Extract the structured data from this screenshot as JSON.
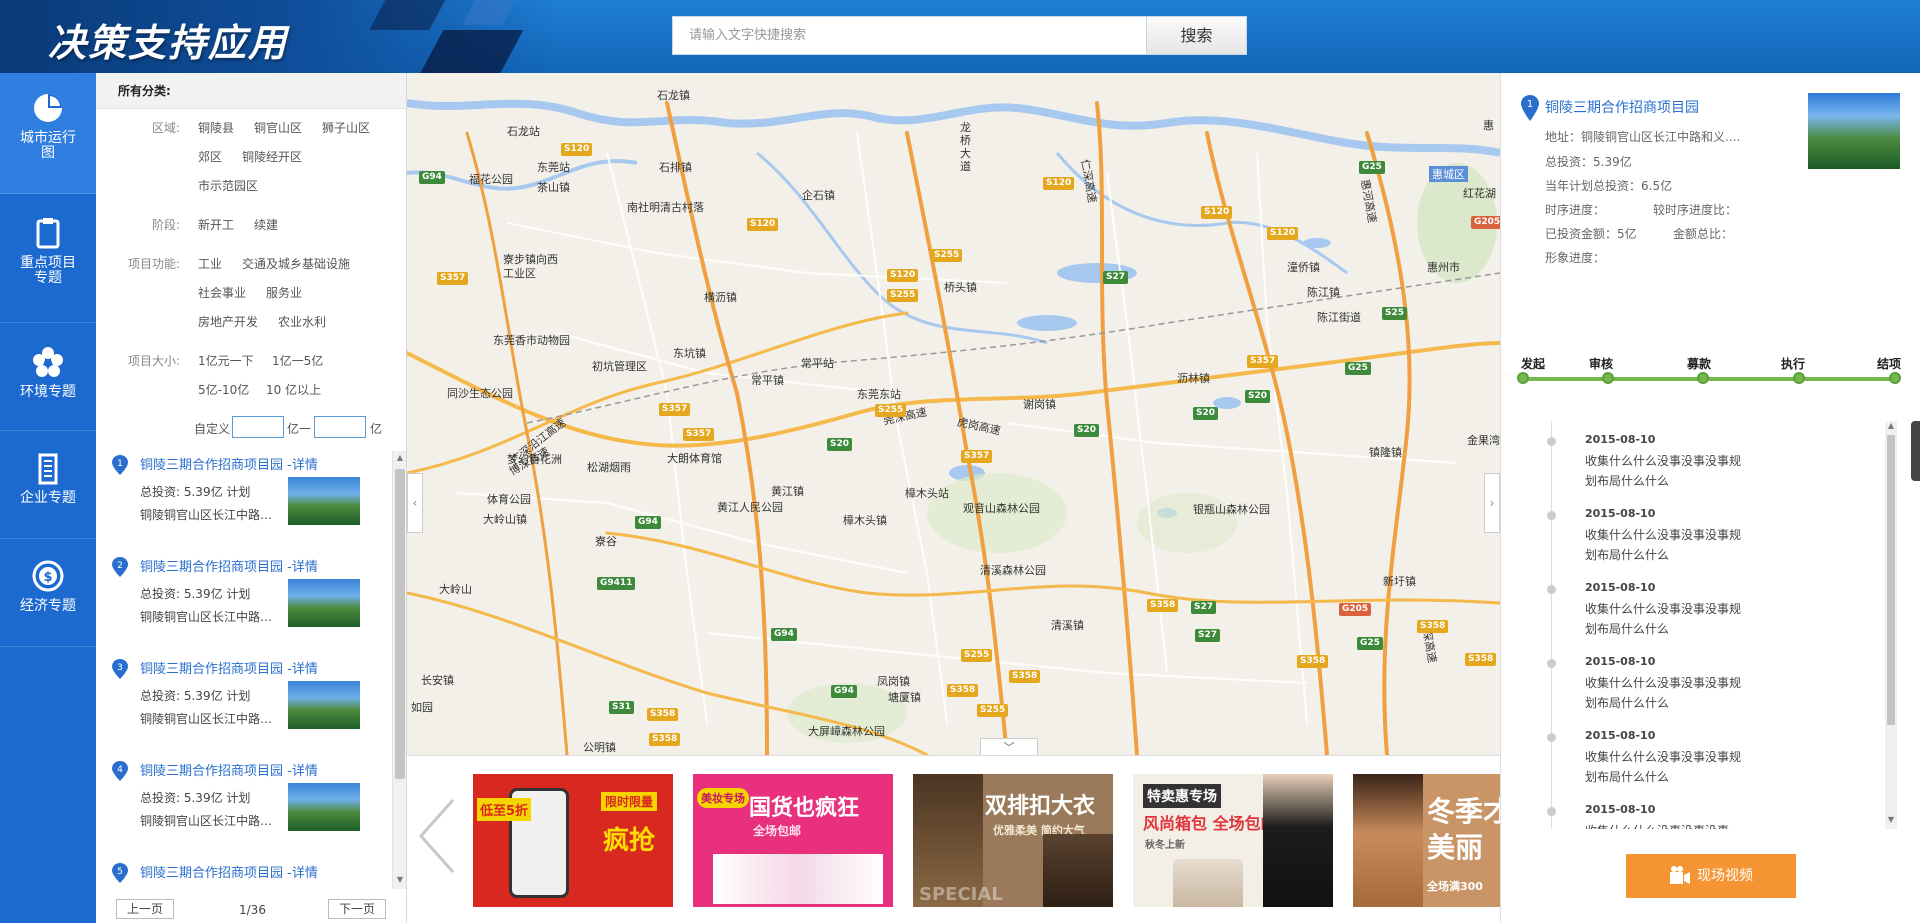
{
  "app": {
    "title": "决策支持应用"
  },
  "search": {
    "placeholder": "请输入文字快捷搜索",
    "button": "搜索"
  },
  "nav": [
    {
      "label": "城市运行图",
      "icon": "pie-chart-icon"
    },
    {
      "label": "重点项目专题",
      "icon": "clipboard-icon"
    },
    {
      "label": "环境专题",
      "icon": "flower-icon"
    },
    {
      "label": "企业专题",
      "icon": "building-icon"
    },
    {
      "label": "经济专题",
      "icon": "currency-icon"
    }
  ],
  "filters": {
    "all": "所有分类:",
    "region": {
      "label": "区域:",
      "options": [
        "铜陵县",
        "铜官山区",
        "狮子山区",
        "郊区",
        "铜陵经开区",
        "市示范园区"
      ]
    },
    "stage": {
      "label": "阶段:",
      "options": [
        "新开工",
        "续建"
      ]
    },
    "function": {
      "label": "项目功能:",
      "options": [
        "工业",
        "交通及城乡基础设施",
        "社会事业",
        "服务业",
        "房地产开发",
        "农业水利"
      ]
    },
    "size": {
      "label": "项目大小:",
      "options": [
        "1亿元一下",
        "1亿一5亿",
        "5亿-10亿",
        "10 亿以上"
      ]
    },
    "custom": {
      "label": "自定义",
      "unit1": "亿一",
      "unit2": "亿"
    }
  },
  "projects": [
    {
      "num": "1",
      "title": "铜陵三期合作招商项目园 -详情",
      "invest": "总投资: 5.39亿 计划",
      "addr": "铜陵铜官山区长江中路…"
    },
    {
      "num": "2",
      "title": "铜陵三期合作招商项目园 -详情",
      "invest": "总投资: 5.39亿 计划",
      "addr": "铜陵铜官山区长江中路…"
    },
    {
      "num": "3",
      "title": "铜陵三期合作招商项目园 -详情",
      "invest": "总投资: 5.39亿 计划",
      "addr": "铜陵铜官山区长江中路…"
    },
    {
      "num": "4",
      "title": "铜陵三期合作招商项目园 -详情",
      "invest": "总投资: 5.39亿 计划",
      "addr": "铜陵铜官山区长江中路…"
    },
    {
      "num": "5",
      "title": "铜陵三期合作招商项目园 -详情",
      "invest": "",
      "addr": ""
    }
  ],
  "pager": {
    "prev": "上一页",
    "info": "1/36",
    "next": "下一页"
  },
  "map": {
    "places": [
      "石龙镇",
      "石龙站",
      "东莞站",
      "茶山镇",
      "石排镇",
      "南社明清古村落",
      "企石镇",
      "龙桥大道",
      "桥头镇",
      "寮步镇向西工业区",
      "横沥镇",
      "东莞香市动物园",
      "初坑管理区",
      "东坑镇",
      "常平站",
      "常平镇",
      "东莞东站",
      "谢岗镇",
      "沥林镇",
      "潼侨镇",
      "陈江镇",
      "陈江街道",
      "惠州市",
      "惠城区",
      "红花湖",
      "梦幻百花洲",
      "松湖烟雨",
      "大朗体育馆",
      "体育公园",
      "大岭山镇",
      "黄江镇",
      "黄江人民公园",
      "樟木头站",
      "樟木头镇",
      "观音山森林公园",
      "银瓶山森林公园",
      "清溪森林公园",
      "清溪镇",
      "塘厦镇",
      "大屏嶂森林公园",
      "凤岗镇",
      "公明镇",
      "长安镇",
      "新圩镇",
      "镇隆镇",
      "金果湾",
      "福花公园",
      "同沙生态公园",
      "寮谷",
      "大岭山",
      "莞深高速",
      "虎岗高速",
      "博深高速",
      "长深高速",
      "惠",
      "广深沿江高速",
      "仁深高速",
      "惠河高速",
      "如园"
    ],
    "roads": [
      "S120",
      "G94",
      "S357",
      "S255",
      "S27",
      "G25",
      "S20",
      "S358",
      "G9411",
      "S31",
      "G205",
      "S25"
    ]
  },
  "banners": [
    {
      "text1": "限时限量",
      "text2": "疯抢",
      "tag": "低至5折",
      "bg": "#d9281f"
    },
    {
      "text1": "国货也疯狂",
      "text2": "全场包邮",
      "tag": "美妆专场",
      "bg": "#e8307e"
    },
    {
      "text1": "双排扣大衣",
      "text2": "优雅柔美 简约大气",
      "tag": "SPECIAL",
      "bg": "#9a7a5a"
    },
    {
      "text1": "特卖惠专场",
      "text2": "风尚箱包 全场包邮",
      "tag": "秋冬上新",
      "bg": "#f4efe6"
    },
    {
      "text1": "冬季才",
      "text2": "美丽",
      "tag": "全场满300",
      "bg": "#c99466"
    }
  ],
  "detail": {
    "title": "铜陵三期合作招商项目园",
    "address": "地址：铜陵铜官山区长江中路和义....",
    "invest": "总投资：5.39亿",
    "plan": "当年计划总投资：6.5亿",
    "timeprog": "时序进度：",
    "relprog": "较时序进度比：",
    "invested": "已投资金额：5亿",
    "amountratio": "金额总比：",
    "imageprog": "形象进度："
  },
  "stages": [
    "发起",
    "审核",
    "募款",
    "执行",
    "结项"
  ],
  "timeline": [
    {
      "date": "2015-08-10",
      "text": "收集什么什么没事没事没事规划布局什么什么"
    },
    {
      "date": "2015-08-10",
      "text": "收集什么什么没事没事没事规划布局什么什么"
    },
    {
      "date": "2015-08-10",
      "text": "收集什么什么没事没事没事规划布局什么什么"
    },
    {
      "date": "2015-08-10",
      "text": "收集什么什么没事没事没事规划布局什么什么"
    },
    {
      "date": "2015-08-10",
      "text": "收集什么什么没事没事没事规划布局什么什么"
    },
    {
      "date": "2015-08-10",
      "text": "收集什么什么没事没事没事"
    }
  ],
  "live_button": "现场视频",
  "colors": {
    "header": "#1266b8",
    "nav": "#1c6ad0",
    "accent": "#2a6fce",
    "stage": "#74b84f",
    "live": "#f59432"
  }
}
